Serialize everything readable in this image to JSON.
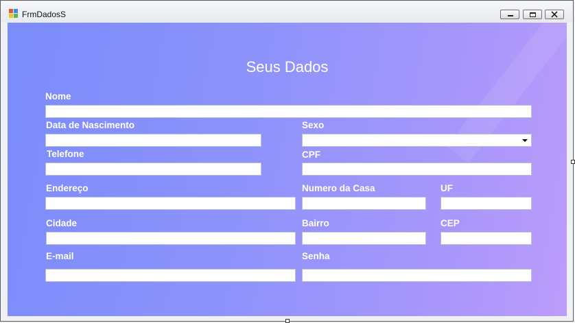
{
  "window": {
    "title": "FrmDadosS"
  },
  "form": {
    "title": "Seus Dados",
    "labels": {
      "nome": "Nome",
      "data_nascimento": "Data de Nascimento",
      "sexo": "Sexo",
      "telefone": "Telefone",
      "cpf": "CPF",
      "endereco": "Endereço",
      "numero_casa": "Numero da Casa",
      "uf": "UF",
      "cidade": "Cidade",
      "bairro": "Bairro",
      "cep": "CEP",
      "email": "E-mail",
      "senha": "Senha"
    },
    "values": {
      "nome": "",
      "data_nascimento": "",
      "sexo": "",
      "telefone": "",
      "cpf": "",
      "endereco": "",
      "numero_casa": "",
      "uf": "",
      "cidade": "",
      "bairro": "",
      "cep": "",
      "email": "",
      "senha": ""
    }
  },
  "colors": {
    "gradient_start": "#7b8cfb",
    "gradient_end": "#bb9cfb",
    "label": "#ffffff"
  },
  "icons": {
    "minimize": "minimize-icon",
    "maximize": "restore-icon",
    "close": "close-icon"
  }
}
